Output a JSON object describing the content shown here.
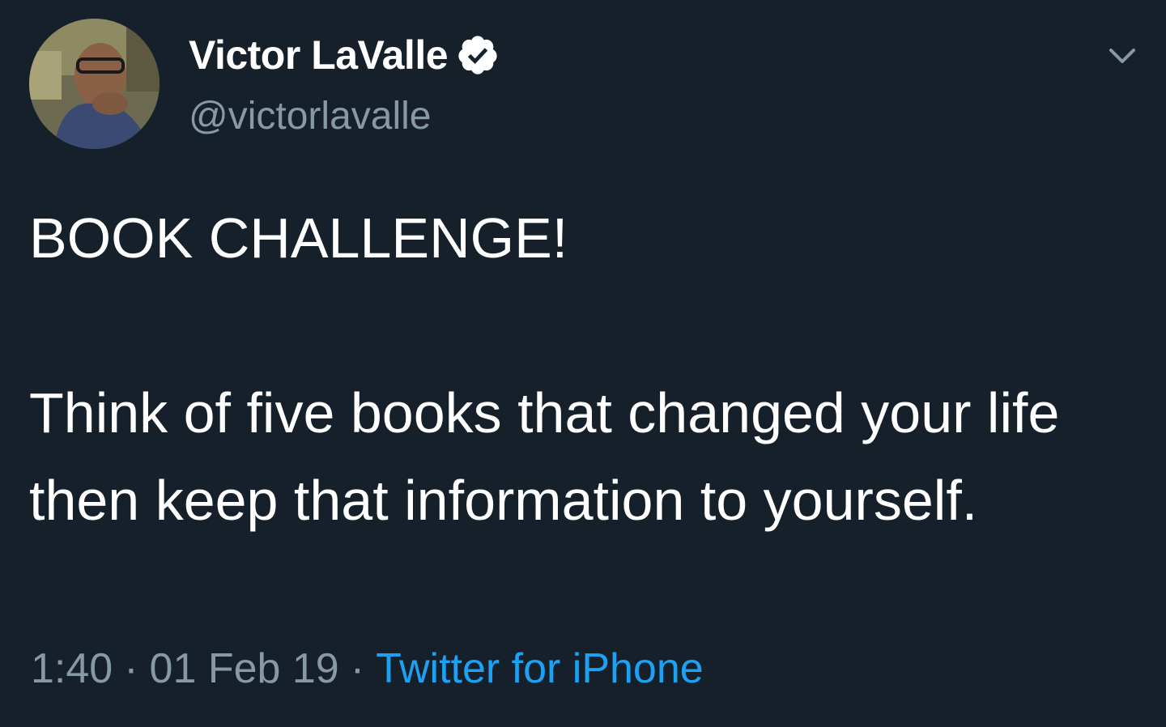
{
  "tweet": {
    "author": {
      "display_name": "Victor LaValle",
      "handle": "@victorlavalle",
      "verified": true,
      "avatar_icon": "avatar-photo"
    },
    "text": "BOOK CHALLENGE!\n\nThink of five books that changed your life then keep that information to yourself.",
    "meta": {
      "time": "1:40",
      "separator": "·",
      "date": "01 Feb 19",
      "source": "Twitter for iPhone"
    },
    "menu_icon": "chevron-down-icon"
  },
  "colors": {
    "background": "#15202b",
    "text_primary": "#ffffff",
    "text_secondary": "#8899a6",
    "link": "#1da1f2"
  }
}
